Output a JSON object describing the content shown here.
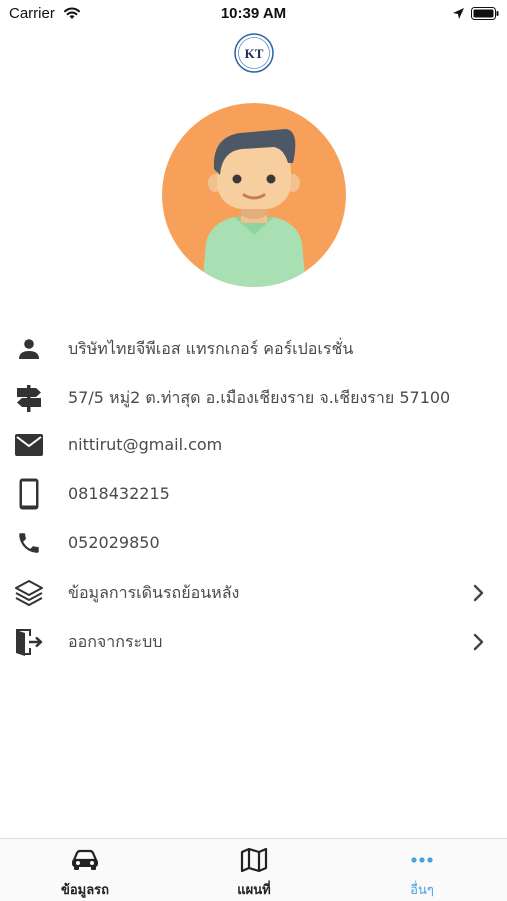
{
  "status_bar": {
    "carrier": "Carrier",
    "time": "10:39 AM"
  },
  "logo": {
    "text": "KT"
  },
  "profile": {
    "company": "บริษัทไทยจีพีเอส แทรกเกอร์ คอร์เปอเรชั่น",
    "address": "57/5  หมู่2 ต.ท่าสุด อ.เมืองเชียงราย จ.เชียงราย 57100",
    "email": "nittirut@gmail.com",
    "mobile": "0818432215",
    "phone": "052029850"
  },
  "menu": {
    "history_label": "ข้อมูลการเดินรถย้อนหลัง",
    "logout_label": "ออกจากระบบ"
  },
  "tabs": [
    {
      "label": "ข้อมูลรถ",
      "icon": "car-icon",
      "active": false
    },
    {
      "label": "แผนที่",
      "icon": "map-icon",
      "active": false
    },
    {
      "label": "อื่นๆ",
      "icon": "more-icon",
      "active": true
    }
  ],
  "colors": {
    "accent": "#4aa3df",
    "icon": "#333333",
    "avatar_bg": "#f6a05a"
  }
}
